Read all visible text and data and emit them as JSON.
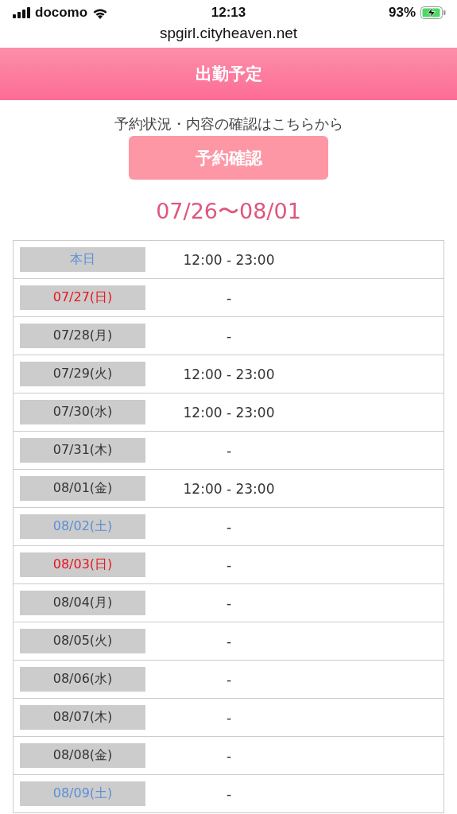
{
  "status_bar": {
    "carrier": "docomo",
    "time": "12:13",
    "battery": "93%",
    "charging": true
  },
  "address_bar": {
    "url": "spgirl.cityheaven.net"
  },
  "header": {
    "title": "出勤予定"
  },
  "reservation": {
    "note": "予約状況・内容の確認はこちらから",
    "button": "予約確認"
  },
  "schedule": {
    "range": "07/26〜08/01",
    "rows": [
      {
        "day": "本日",
        "color": "#5b8fd6",
        "hours": "12:00 - 23:00"
      },
      {
        "day": "07/27(日)",
        "color": "#e8141c",
        "hours": "-"
      },
      {
        "day": "07/28(月)",
        "color": "#333333",
        "hours": "-"
      },
      {
        "day": "07/29(火)",
        "color": "#333333",
        "hours": "12:00 - 23:00"
      },
      {
        "day": "07/30(水)",
        "color": "#333333",
        "hours": "12:00 - 23:00"
      },
      {
        "day": "07/31(木)",
        "color": "#333333",
        "hours": "-"
      },
      {
        "day": "08/01(金)",
        "color": "#333333",
        "hours": "12:00 - 23:00"
      },
      {
        "day": "08/02(土)",
        "color": "#5b8fd6",
        "hours": "-"
      },
      {
        "day": "08/03(日)",
        "color": "#e8141c",
        "hours": "-"
      },
      {
        "day": "08/04(月)",
        "color": "#333333",
        "hours": "-"
      },
      {
        "day": "08/05(火)",
        "color": "#333333",
        "hours": "-"
      },
      {
        "day": "08/06(水)",
        "color": "#333333",
        "hours": "-"
      },
      {
        "day": "08/07(木)",
        "color": "#333333",
        "hours": "-"
      },
      {
        "day": "08/08(金)",
        "color": "#333333",
        "hours": "-"
      },
      {
        "day": "08/09(土)",
        "color": "#5b8fd6",
        "hours": "-"
      }
    ]
  }
}
